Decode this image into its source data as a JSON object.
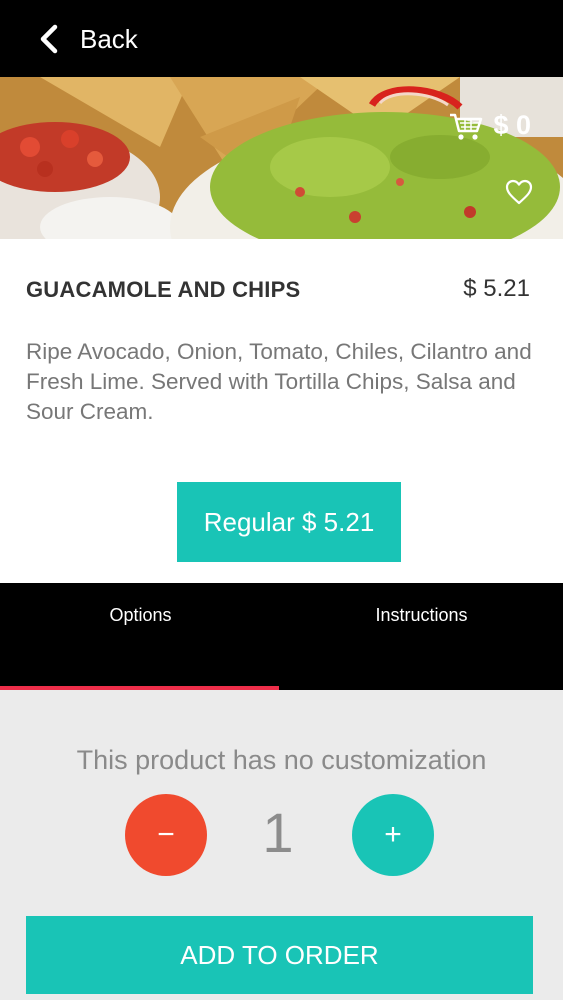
{
  "header": {
    "back_label": "Back",
    "back_icon": "chevron-left-icon"
  },
  "hero": {
    "cart_total": "$ 0",
    "cart_icon": "shopping-cart-icon",
    "favorite_icon": "heart-outline-icon"
  },
  "product": {
    "name": "GUACAMOLE AND CHIPS",
    "price": "$ 5.21",
    "description": "Ripe Avocado, Onion, Tomato, Chiles, Cilantro and Fresh Lime. Served with Tortilla Chips, Salsa and Sour Cream.",
    "variant_label": "Regular $ 5.21"
  },
  "tabs": [
    {
      "label": "Options",
      "active": true
    },
    {
      "label": "Instructions",
      "active": false
    }
  ],
  "options": {
    "message": "This product has no customization",
    "quantity": "1",
    "decrement_label": "−",
    "increment_label": "+"
  },
  "add_to_order_label": "ADD TO ORDER",
  "colors": {
    "accent": "#19c4b6",
    "decrement": "#f04a2e",
    "tab_indicator": "#ee2e4a",
    "bar": "#000000"
  }
}
